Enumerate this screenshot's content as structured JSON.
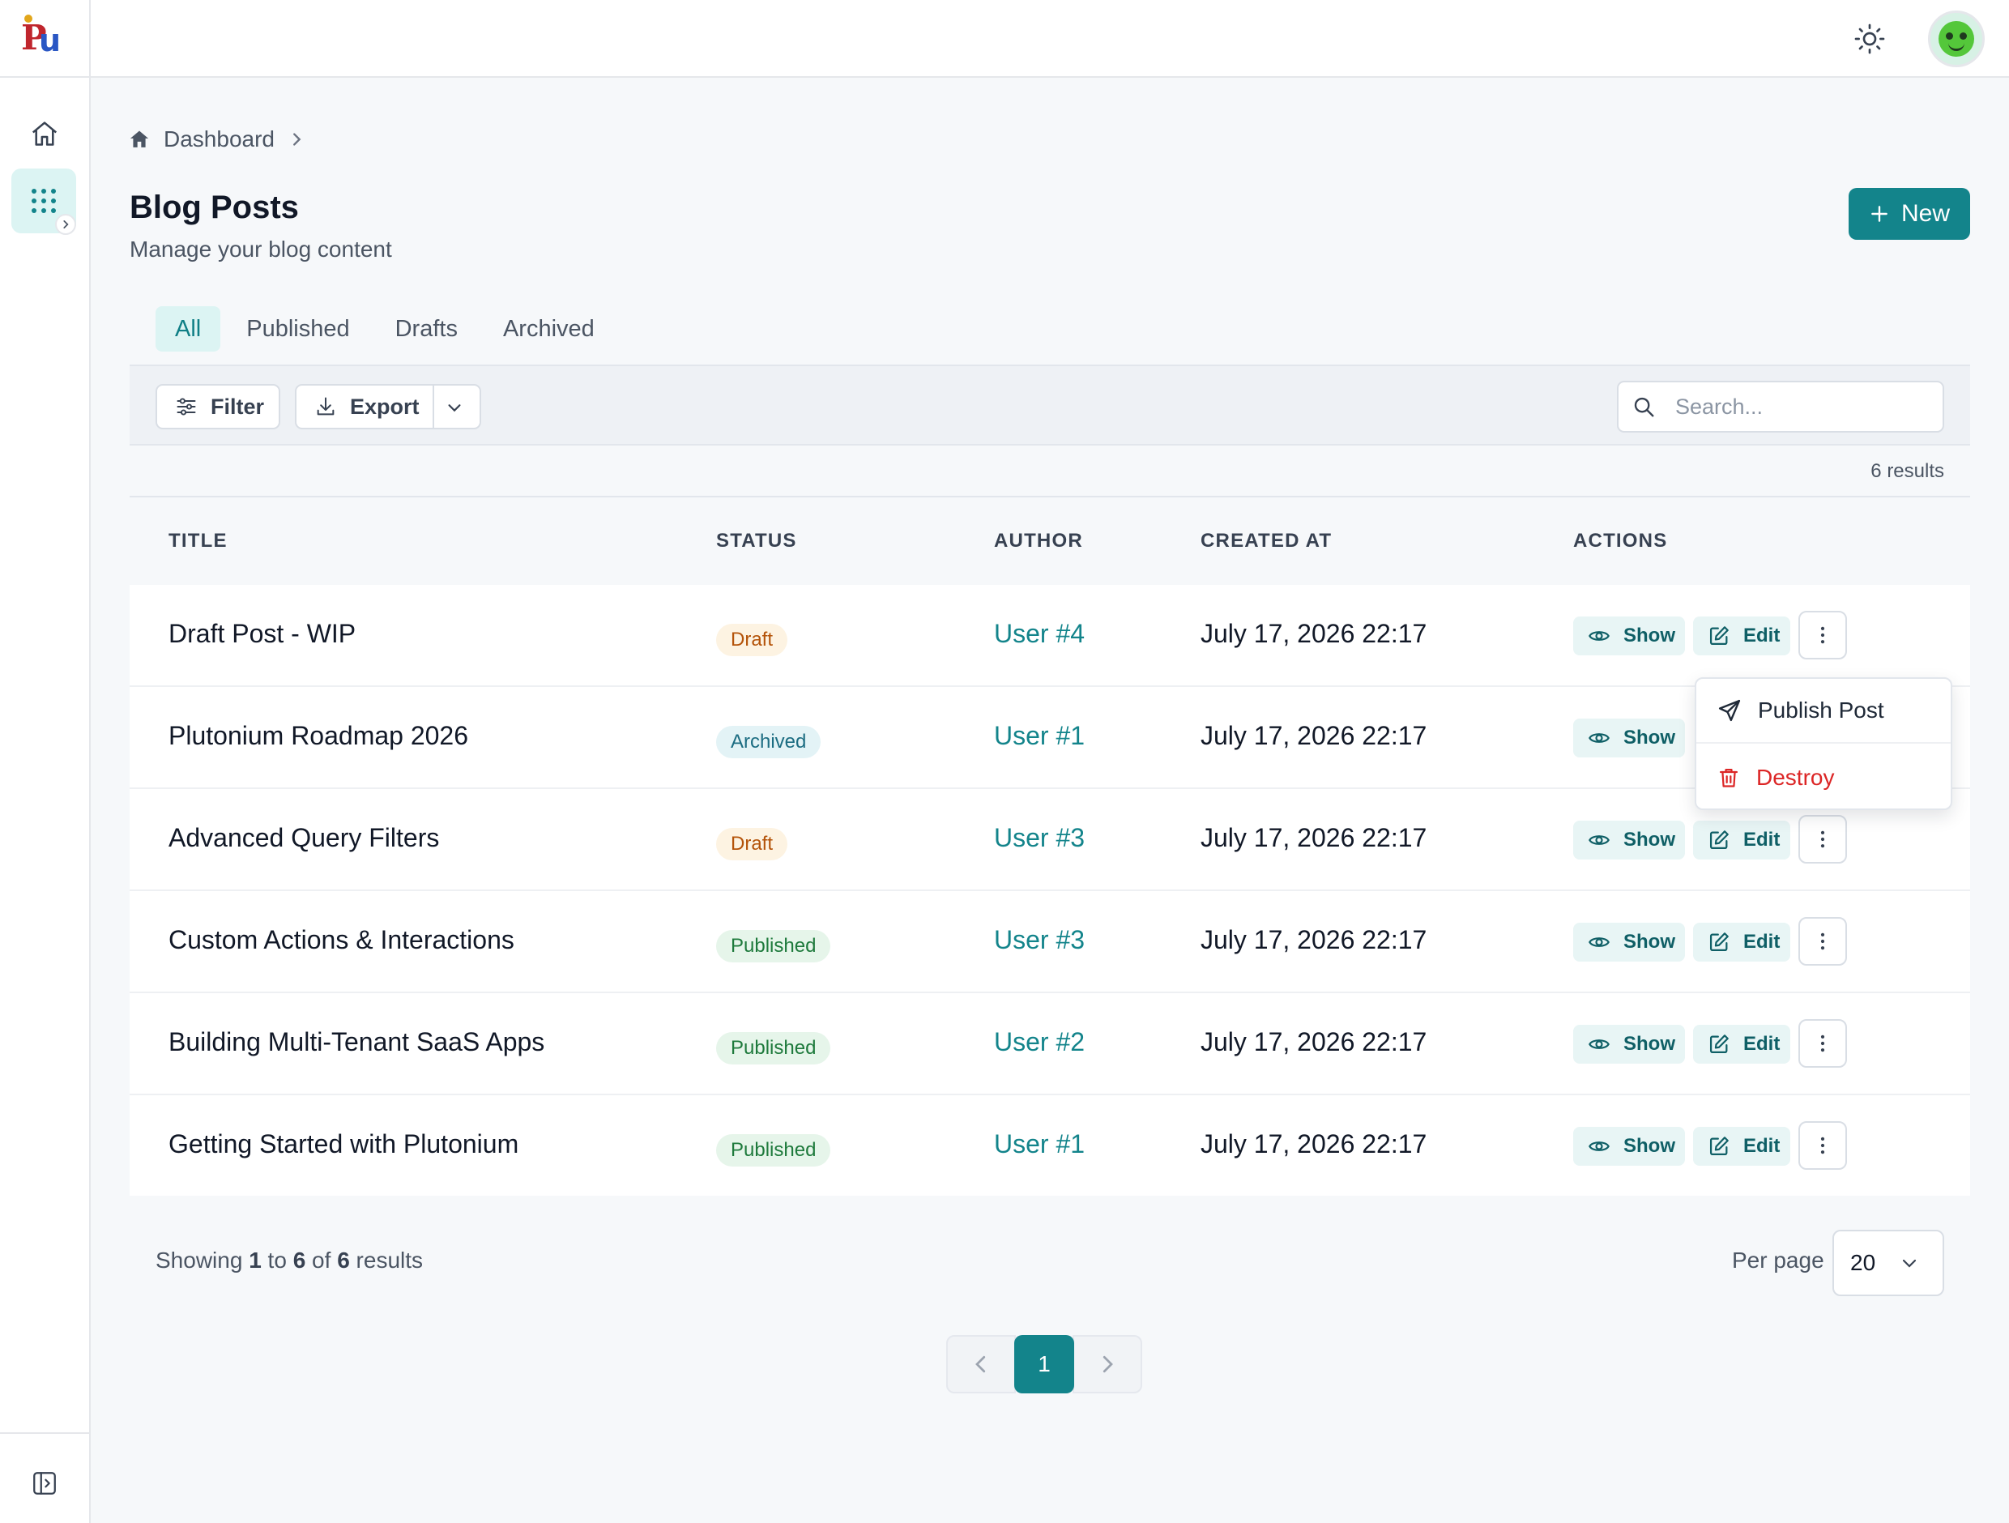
{
  "app": {
    "logo_text_p": "P",
    "logo_text_u": "u"
  },
  "topbar": {
    "theme_icon": "sun-icon",
    "avatar_icon": "frog-avatar"
  },
  "sidebar": {
    "items": [
      {
        "name": "home",
        "icon": "home-icon"
      },
      {
        "name": "apps",
        "icon": "grid-icon"
      }
    ],
    "collapse_icon": "panel-toggle-icon"
  },
  "breadcrumb": {
    "home_label": "Dashboard"
  },
  "page": {
    "title": "Blog Posts",
    "subtitle": "Manage your blog content",
    "new_label": "New"
  },
  "tabs": [
    {
      "label": "All",
      "active": true
    },
    {
      "label": "Published",
      "active": false
    },
    {
      "label": "Drafts",
      "active": false
    },
    {
      "label": "Archived",
      "active": false
    }
  ],
  "toolbar": {
    "filter_label": "Filter",
    "export_label": "Export",
    "search_placeholder": "Search..."
  },
  "results": {
    "count_text": "6 results"
  },
  "table": {
    "headers": [
      "TITLE",
      "STATUS",
      "AUTHOR",
      "CREATED AT",
      "ACTIONS"
    ],
    "rows": [
      {
        "title": "Draft Post - WIP",
        "status": "Draft",
        "author": "User #4",
        "created_at": "July 17, 2026 22:17"
      },
      {
        "title": "Plutonium Roadmap 2026",
        "status": "Archived",
        "author": "User #1",
        "created_at": "July 17, 2026 22:17"
      },
      {
        "title": "Advanced Query Filters",
        "status": "Draft",
        "author": "User #3",
        "created_at": "July 17, 2026 22:17"
      },
      {
        "title": "Custom Actions & Interactions",
        "status": "Published",
        "author": "User #3",
        "created_at": "July 17, 2026 22:17"
      },
      {
        "title": "Building Multi-Tenant SaaS Apps",
        "status": "Published",
        "author": "User #2",
        "created_at": "July 17, 2026 22:17"
      },
      {
        "title": "Getting Started with Plutonium",
        "status": "Published",
        "author": "User #1",
        "created_at": "July 17, 2026 22:17"
      }
    ],
    "actions": {
      "show_label": "Show",
      "edit_label": "Edit"
    }
  },
  "dropdown": {
    "publish_label": "Publish Post",
    "destroy_label": "Destroy"
  },
  "footer": {
    "showing_prefix": "Showing",
    "from": "1",
    "to_word": "to",
    "to": "6",
    "of_word": "of",
    "total": "6",
    "results_word": "results",
    "per_page_label": "Per page",
    "per_page_value": "20",
    "current_page": "1"
  },
  "colors": {
    "primary": "#13848b",
    "primary_light": "#dcf4f3",
    "danger": "#dc2626",
    "draft": "#b45309",
    "archived": "#1c6d82",
    "published": "#1e7a3c"
  }
}
